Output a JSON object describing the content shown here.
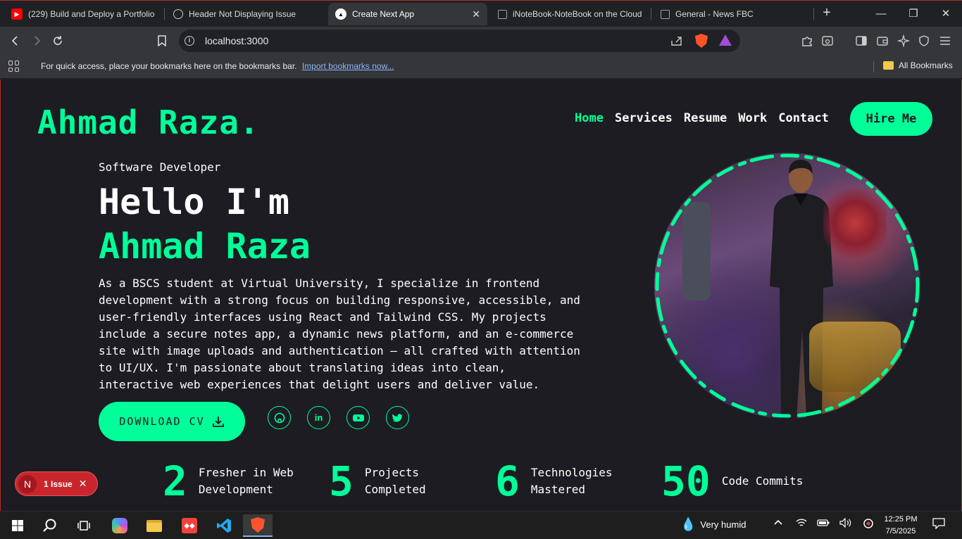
{
  "browser": {
    "tabs": [
      {
        "label": "(229) Build and Deploy a Portfolio",
        "icon": "youtube-icon",
        "color": "#ff0000"
      },
      {
        "label": "Header Not Displaying Issue",
        "icon": "openai-icon",
        "color": "#888888"
      },
      {
        "label": "Create Next App",
        "icon": "nextjs-icon",
        "color": "#ffffff",
        "active": true
      },
      {
        "label": "iNoteBook-NoteBook on the Cloud",
        "icon": "page-icon",
        "color": "#9aa0a6"
      },
      {
        "label": "General - News FBC",
        "icon": "page-icon",
        "color": "#9aa0a6"
      }
    ],
    "url": "localhost:3000",
    "bookmarks_hint": "For quick access, place your bookmarks here on the bookmarks bar.",
    "import_link": "Import bookmarks now...",
    "all_bookmarks": "All Bookmarks"
  },
  "site": {
    "logo": "Ahmad Raza",
    "logo_dot": ".",
    "nav": [
      "Home",
      "Services",
      "Resume",
      "Work",
      "Contact"
    ],
    "hire_button": "Hire Me",
    "role": "Software Developer",
    "greeting": "Hello I'm",
    "name": "Ahmad Raza",
    "bio": "As a BSCS student at Virtual University, I specialize in frontend development with a strong focus on building responsive, accessible, and user-friendly interfaces using React and Tailwind CSS. My projects include a secure notes app, a dynamic news platform, and an e-commerce site with image uploads and authentication — all crafted with attention to UI/UX. I'm passionate about translating ideas into clean, interactive web experiences that delight users and deliver value.",
    "download_cv": "DOWNLOAD CV",
    "socials": [
      "github-icon",
      "linkedin-icon",
      "youtube-icon",
      "twitter-icon"
    ],
    "stats": [
      {
        "number": "2",
        "line1": "Fresher in Web",
        "line2": "Development"
      },
      {
        "number": "5",
        "line1": "Projects",
        "line2": "Completed"
      },
      {
        "number": "6",
        "line1": "Technologies",
        "line2": "Mastered"
      },
      {
        "number": "50",
        "line1": "Code Commits",
        "line2": ""
      }
    ],
    "accent": "#00ff99"
  },
  "devtools": {
    "avatar": "N",
    "issue_label": "1 Issue"
  },
  "taskbar": {
    "weather": "Very humid",
    "time": "12:25 PM",
    "date": "7/5/2025"
  }
}
